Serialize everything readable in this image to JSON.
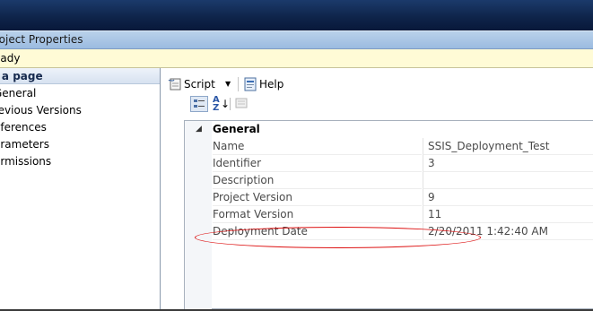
{
  "window": {
    "title": "roject Properties"
  },
  "status": {
    "text": "eady"
  },
  "left_panel": {
    "header": "t a page",
    "items": [
      {
        "label": "General",
        "icon": "page-icon"
      },
      {
        "label": "revious Versions",
        "icon": "page-icon"
      },
      {
        "label": "eferences",
        "icon": "page-icon"
      },
      {
        "label": "arameters",
        "icon": "page-icon"
      },
      {
        "label": "ermissions",
        "icon": "page-icon"
      }
    ]
  },
  "toolbar": {
    "script_label": "Script",
    "script_icon": "script-icon",
    "dropdown_icon": "dropdown-arrow-icon",
    "help_label": "Help",
    "help_icon": "help-icon"
  },
  "grid": {
    "buttons": [
      "categorized-icon",
      "alphabetical-icon",
      "property-pages-icon"
    ],
    "category": "General",
    "rows": [
      {
        "name": "Name",
        "value": "SSIS_Deployment_Test"
      },
      {
        "name": "Identifier",
        "value": "3"
      },
      {
        "name": "Description",
        "value": ""
      },
      {
        "name": "Project Version",
        "value": "9",
        "highlighted": true
      },
      {
        "name": "Format Version",
        "value": "11"
      },
      {
        "name": "Deployment Date",
        "value": "2/20/2011 1:42:40 AM"
      }
    ]
  },
  "colors": {
    "highlight_oval": "#dd1111",
    "status_bg": "#fffbd6",
    "title_bg": "#a9c6e6"
  }
}
